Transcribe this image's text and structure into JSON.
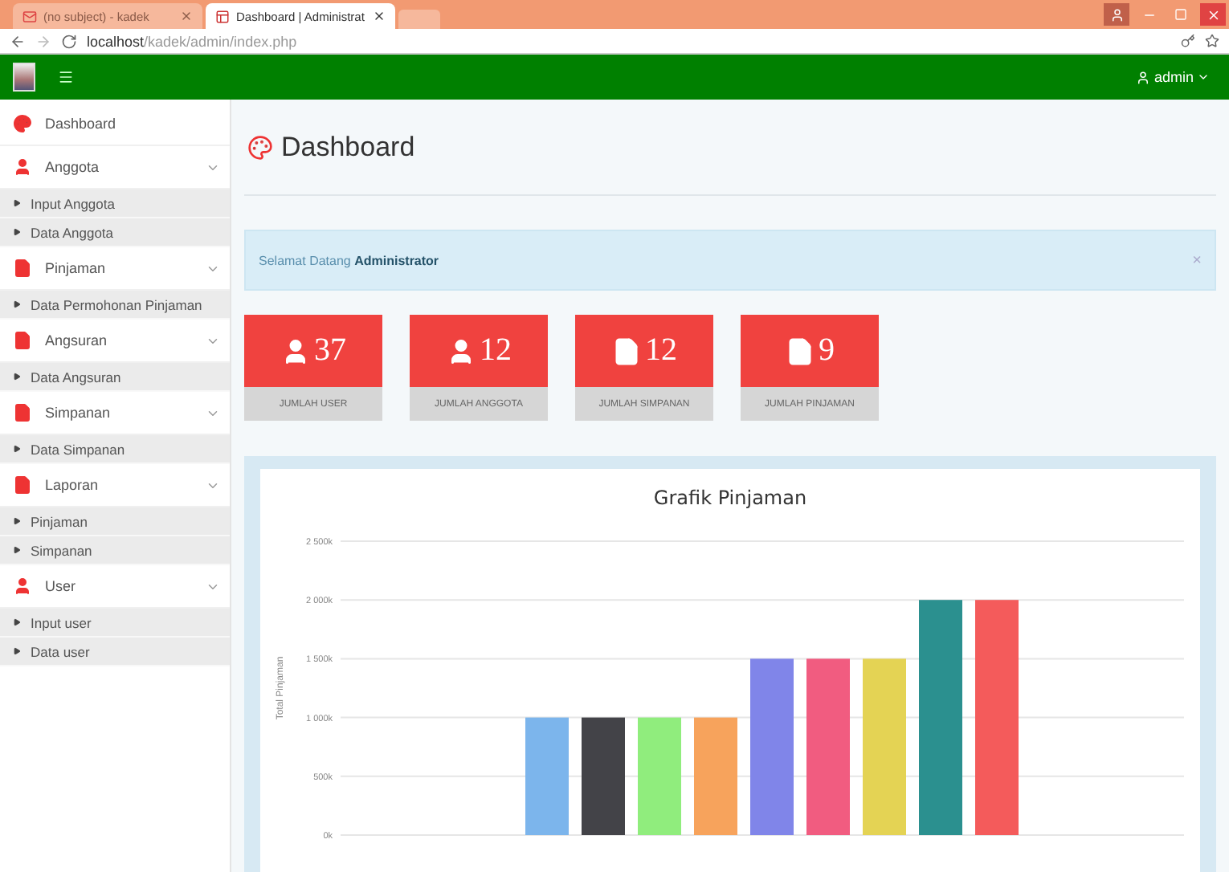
{
  "browser": {
    "tabs": [
      {
        "title": "(no subject) - kadek",
        "selected": false
      },
      {
        "title": "Dashboard | Administrat",
        "selected": true
      }
    ],
    "address": {
      "host": "localhost",
      "path": "/kadek/admin/index.php"
    }
  },
  "navbar": {
    "user": "admin"
  },
  "sidebar": {
    "items": [
      {
        "label": "Dashboard"
      },
      {
        "label": "Anggota",
        "expanded": true,
        "children": [
          {
            "label": "Input Anggota"
          },
          {
            "label": "Data Anggota"
          }
        ]
      },
      {
        "label": "Pinjaman",
        "expanded": true,
        "children": [
          {
            "label": "Data Permohonan Pinjaman"
          }
        ]
      },
      {
        "label": "Angsuran",
        "expanded": true,
        "children": [
          {
            "label": "Data Angsuran"
          }
        ]
      },
      {
        "label": "Simpanan",
        "expanded": true,
        "children": [
          {
            "label": "Data Simpanan"
          }
        ]
      },
      {
        "label": "Laporan",
        "expanded": true,
        "children": [
          {
            "label": "Pinjaman"
          },
          {
            "label": "Simpanan"
          }
        ]
      },
      {
        "label": "User",
        "expanded": true,
        "children": [
          {
            "label": "Input user"
          },
          {
            "label": "Data user"
          }
        ]
      }
    ]
  },
  "page": {
    "title": "Dashboard"
  },
  "alert": {
    "text": "Selamat Datang **Administrator**",
    "close": "×"
  },
  "stats": [
    {
      "value": "37",
      "label": "JUMLAH USER"
    },
    {
      "value": "12",
      "label": "JUMLAH ANGGOTA"
    },
    {
      "value": "12",
      "label": "JUMLAH SIMPANAN"
    },
    {
      "value": "9",
      "label": "JUMLAH PINJAMAN"
    }
  ],
  "chart": {
    "chart_data": {
      "type": "bar",
      "title": "Grafik Pinjaman",
      "ylabel": "Total Pinjaman",
      "ylim": [
        0,
        2500
      ],
      "grid": true,
      "yticks": [
        {
          "value": 0,
          "label": "0k"
        },
        {
          "value": 500,
          "label": "500k"
        },
        {
          "value": 1000,
          "label": "1 000k"
        },
        {
          "value": 1500,
          "label": "1 500k"
        },
        {
          "value": 2000,
          "label": "2 000k"
        },
        {
          "value": 2500,
          "label": "2 500k"
        }
      ],
      "series": [
        {
          "color": "#7cb5ec",
          "values": [
            1000
          ]
        },
        {
          "color": "#434348",
          "values": [
            1000
          ]
        },
        {
          "color": "#90ed7d",
          "values": [
            1000
          ]
        },
        {
          "color": "#f7a35c",
          "values": [
            1000
          ]
        },
        {
          "color": "#8085e9",
          "values": [
            1500
          ]
        },
        {
          "color": "#f15c80",
          "values": [
            1500
          ]
        },
        {
          "color": "#e4d354",
          "values": [
            1500
          ]
        },
        {
          "color": "#2b908f",
          "values": [
            2000
          ]
        },
        {
          "color": "#f45b5b",
          "values": [
            2000
          ]
        }
      ]
    }
  }
}
